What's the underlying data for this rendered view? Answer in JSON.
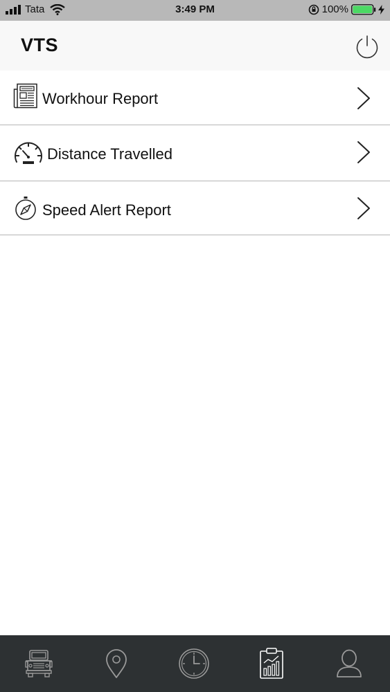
{
  "status_bar": {
    "carrier": "Tata",
    "time": "3:49 PM",
    "battery_percent": "100%"
  },
  "header": {
    "title": "VTS"
  },
  "menu": [
    {
      "label": "Workhour Report",
      "icon": "newspaper-icon"
    },
    {
      "label": "Distance Travelled",
      "icon": "speedometer-icon"
    },
    {
      "label": "Speed Alert Report",
      "icon": "compass-icon"
    }
  ],
  "tab_bar": {
    "tabs": [
      {
        "icon": "truck-icon",
        "selected": false
      },
      {
        "icon": "location-pin-icon",
        "selected": false
      },
      {
        "icon": "clock-icon",
        "selected": false
      },
      {
        "icon": "report-clipboard-icon",
        "selected": true
      },
      {
        "icon": "user-icon",
        "selected": false
      }
    ]
  },
  "colors": {
    "status_bar_bg": "#b8b8b8",
    "header_bg": "#f8f8f8",
    "tab_bar_bg": "#2d3133",
    "tab_icon": "#9a9a9a",
    "tab_icon_selected": "#ffffff",
    "battery_green": "#4cd964"
  }
}
